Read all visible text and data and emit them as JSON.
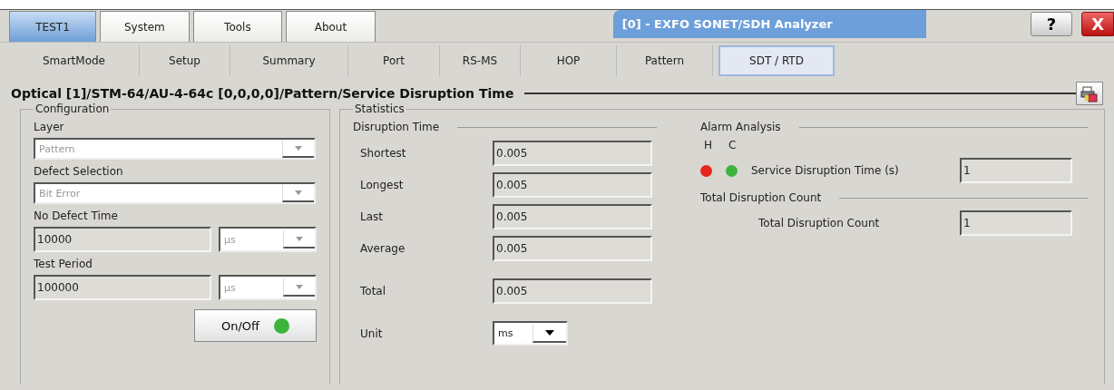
{
  "top_tabs": [
    {
      "label": "TEST1",
      "selected": true
    },
    {
      "label": "System",
      "selected": false
    },
    {
      "label": "Tools",
      "selected": false
    },
    {
      "label": "About",
      "selected": false
    }
  ],
  "window": {
    "title": "[0] - EXFO  SONET/SDH Analyzer",
    "help": "?",
    "close": "X"
  },
  "sub_tabs": [
    {
      "label": "SmartMode",
      "selected": false
    },
    {
      "label": "Setup",
      "selected": false
    },
    {
      "label": "Summary",
      "selected": false
    },
    {
      "label": "Port",
      "selected": false
    },
    {
      "label": "RS-MS",
      "selected": false
    },
    {
      "label": "HOP",
      "selected": false
    },
    {
      "label": "Pattern",
      "selected": false
    },
    {
      "label": "SDT / RTD",
      "selected": true
    }
  ],
  "breadcrumb": "Optical [1]/STM-64/AU-4-64c [0,0,0,0]/Pattern/Service Disruption Time",
  "configuration": {
    "title": "Configuration",
    "layer": {
      "label": "Layer",
      "value": "Pattern",
      "disabled": true
    },
    "defect_selection": {
      "label": "Defect Selection",
      "value": "Bit Error",
      "disabled": true
    },
    "no_defect_time": {
      "label": "No Defect Time",
      "value": "10000",
      "unit": "µs",
      "unit_disabled": true
    },
    "test_period": {
      "label": "Test Period",
      "value": "100000",
      "unit": "µs",
      "unit_disabled": true
    },
    "on_off": {
      "label": "On/Off",
      "on": true
    }
  },
  "statistics": {
    "title": "Statistics",
    "disruption_time": {
      "title": "Disruption Time",
      "rows": [
        {
          "label": "Shortest",
          "value": "0.005"
        },
        {
          "label": "Longest",
          "value": "0.005"
        },
        {
          "label": "Last",
          "value": "0.005"
        },
        {
          "label": "Average",
          "value": "0.005"
        },
        {
          "label": "Total",
          "value": "0.005"
        }
      ],
      "unit": {
        "label": "Unit",
        "value": "ms",
        "disabled": false
      }
    },
    "alarm_analysis": {
      "title": "Alarm Analysis",
      "headers": [
        "H",
        "C"
      ],
      "alarm": {
        "label": "Service Disruption Time (s)",
        "value": "1",
        "indicators": [
          {
            "color": "#e8251e"
          },
          {
            "color": "#3cb43c"
          }
        ]
      }
    },
    "total_disruption_count": {
      "title": "Total Disruption Count",
      "label": "Total Disruption Count",
      "value": "1"
    }
  }
}
